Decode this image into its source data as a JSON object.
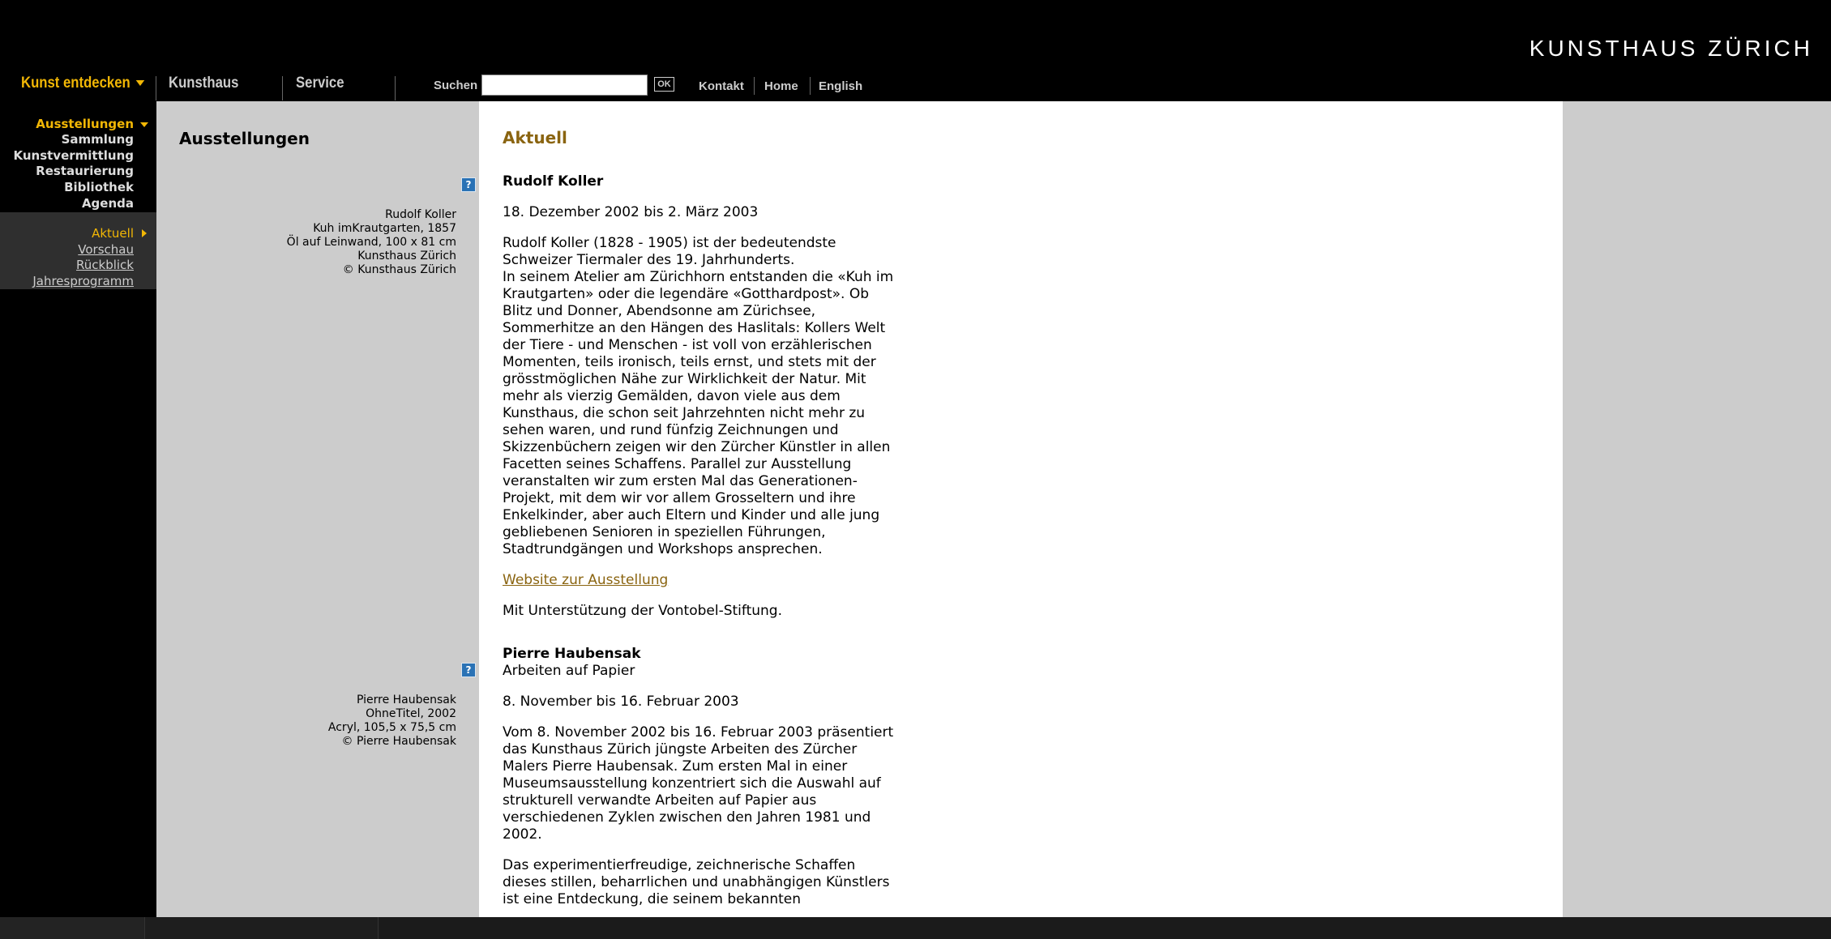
{
  "header": {
    "logo": "KUNSTHAUS ZÜRICH",
    "nav": {
      "kunst_entdecken": "Kunst entdecken",
      "kunsthaus": "Kunsthaus",
      "service": "Service"
    },
    "search": {
      "label": "Suchen",
      "value": "",
      "ok": "OK"
    },
    "links": {
      "kontakt": "Kontakt",
      "home": "Home",
      "english": "English"
    }
  },
  "sidebar": {
    "items": [
      "Ausstellungen",
      "Sammlung",
      "Kunstvermittlung",
      "Restaurierung",
      "Bibliothek",
      "Agenda"
    ],
    "subitems": [
      "Aktuell",
      "Vorschau",
      "Rückblick",
      "Jahresprogramm"
    ]
  },
  "midcol": {
    "title": "Ausstellungen",
    "help": "?",
    "caption1": [
      "Rudolf Koller",
      "Kuh imKrautgarten, 1857",
      "Öl auf Leinwand, 100 x 81 cm",
      "Kunsthaus Zürich",
      "© Kunsthaus Zürich"
    ],
    "caption2": [
      "Pierre Haubensak",
      "OhneTitel, 2002",
      "Acryl, 105,5 x 75,5 cm",
      "© Pierre Haubensak"
    ]
  },
  "main": {
    "section_title": "Aktuell",
    "exhibitions": [
      {
        "title": "Rudolf Koller",
        "dates": "18. Dezember 2002 bis 2. März 2003",
        "description": "Rudolf Koller (1828 - 1905) ist der bedeutendste Schweizer Tiermaler des 19. Jahrhunderts.\nIn seinem Atelier am Zürichhorn entstanden die «Kuh im Krautgarten» oder die legendäre «Gotthardpost». Ob Blitz und Donner, Abendsonne am Zürichsee, Sommerhitze an den Hängen des Haslitals: Kollers Welt der Tiere - und Menschen - ist voll von erzählerischen Momenten, teils ironisch, teils ernst, und stets mit der grösstmöglichen Nähe zur Wirklichkeit der Natur. Mit mehr als vierzig Gemälden, davon viele aus dem Kunsthaus, die schon seit Jahrzehnten nicht mehr zu sehen waren, und rund fünfzig Zeichnungen und Skizzenbüchern zeigen wir den Zürcher Künstler in allen Facetten seines Schaffens. Parallel zur Ausstellung veranstalten wir zum ersten Mal das Generationen-Projekt, mit dem wir vor allem Grosseltern und ihre Enkelkinder, aber auch Eltern und Kinder und alle jung gebliebenen Senioren in speziellen Führungen, Stadtrundgängen und Workshops ansprechen.",
        "link": "Website zur Ausstellung",
        "sponsor": "Mit Unterstützung der Vontobel-Stiftung."
      },
      {
        "title": "Pierre Haubensak",
        "subtitle": "Arbeiten auf Papier",
        "dates": "8. November bis 16. Februar 2003",
        "description": "Vom 8. November 2002 bis 16. Februar 2003 präsentiert das Kunsthaus Zürich jüngste Arbeiten des Zürcher Malers Pierre Haubensak. Zum ersten Mal in einer Museumsausstellung konzentriert sich die Auswahl auf strukturell verwandte Arbeiten auf Papier aus verschiedenen Zyklen zwischen den Jahren 1981 und 2002.",
        "description2": "Das experimentierfreudige, zeichnerische Schaffen dieses stillen, beharrlichen und unabhängigen Künstlers ist eine Entdeckung, die seinem bekannten"
      }
    ]
  },
  "colors": {
    "accent": "#f2b705",
    "heading_brown": "#8a6410",
    "gray": "#cccccc",
    "black": "#000000"
  }
}
